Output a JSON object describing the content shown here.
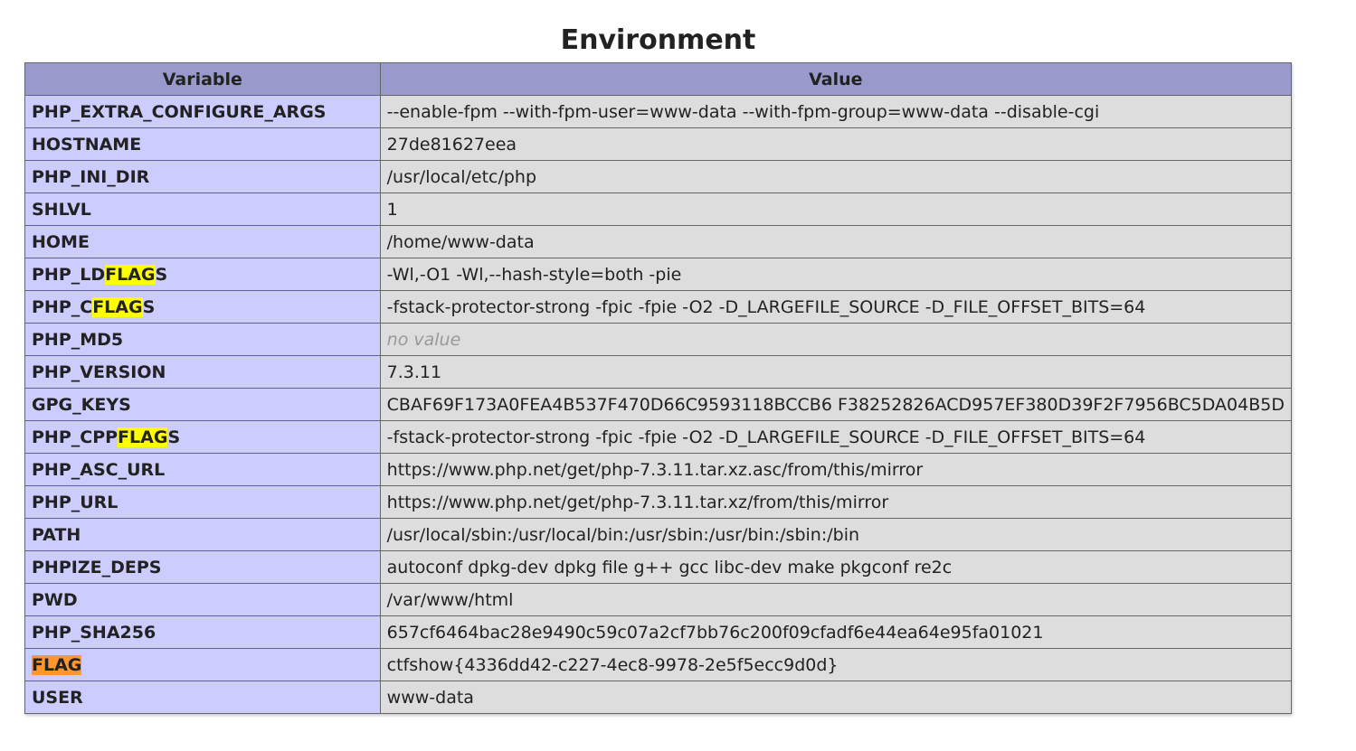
{
  "page": {
    "title": "Environment"
  },
  "table": {
    "headers": {
      "variable": "Variable",
      "value": "Value"
    },
    "highlight_colors": {
      "search_match": "#ffff00",
      "active_match": "#ff9632"
    },
    "rows": [
      {
        "name_parts": [
          "PHP_EXTRA_CONFIGURE_ARGS"
        ],
        "value": "--enable-fpm --with-fpm-user=www-data --with-fpm-group=www-data --disable-cgi"
      },
      {
        "name_parts": [
          "HOSTNAME"
        ],
        "value": "27de81627eea"
      },
      {
        "name_parts": [
          "PHP_INI_DIR"
        ],
        "value": "/usr/local/etc/php"
      },
      {
        "name_parts": [
          "SHLVL"
        ],
        "value": "1"
      },
      {
        "name_parts": [
          "HOME"
        ],
        "value": "/home/www-data"
      },
      {
        "name_parts": [
          "PHP_LD",
          "FLAG",
          "S"
        ],
        "highlight": "yellow",
        "value": "-Wl,-O1 -Wl,--hash-style=both -pie"
      },
      {
        "name_parts": [
          "PHP_C",
          "FLAG",
          "S"
        ],
        "highlight": "yellow",
        "value": "-fstack-protector-strong -fpic -fpie -O2 -D_LARGEFILE_SOURCE -D_FILE_OFFSET_BITS=64"
      },
      {
        "name_parts": [
          "PHP_MD5"
        ],
        "value": "no value",
        "no_value": true
      },
      {
        "name_parts": [
          "PHP_VERSION"
        ],
        "value": "7.3.11"
      },
      {
        "name_parts": [
          "GPG_KEYS"
        ],
        "value": "CBAF69F173A0FEA4B537F470D66C9593118BCCB6 F38252826ACD957EF380D39F2F7956BC5DA04B5D"
      },
      {
        "name_parts": [
          "PHP_CPP",
          "FLAG",
          "S"
        ],
        "highlight": "yellow",
        "value": "-fstack-protector-strong -fpic -fpie -O2 -D_LARGEFILE_SOURCE -D_FILE_OFFSET_BITS=64"
      },
      {
        "name_parts": [
          "PHP_ASC_URL"
        ],
        "value": "https://www.php.net/get/php-7.3.11.tar.xz.asc/from/this/mirror"
      },
      {
        "name_parts": [
          "PHP_URL"
        ],
        "value": "https://www.php.net/get/php-7.3.11.tar.xz/from/this/mirror"
      },
      {
        "name_parts": [
          "PATH"
        ],
        "value": "/usr/local/sbin:/usr/local/bin:/usr/sbin:/usr/bin:/sbin:/bin"
      },
      {
        "name_parts": [
          "PHPIZE_DEPS"
        ],
        "value": "autoconf dpkg-dev dpkg file g++ gcc libc-dev make pkgconf re2c"
      },
      {
        "name_parts": [
          "PWD"
        ],
        "value": "/var/www/html"
      },
      {
        "name_parts": [
          "PHP_SHA256"
        ],
        "value": "657cf6464bac28e9490c59c07a2cf7bb76c200f09cfadf6e44ea64e95fa01021"
      },
      {
        "name_parts": [
          "",
          "FLAG",
          ""
        ],
        "highlight": "orange",
        "value": "ctfshow{4336dd42-c227-4ec8-9978-2e5f5ecc9d0d}"
      },
      {
        "name_parts": [
          "USER"
        ],
        "value": "www-data"
      }
    ]
  }
}
